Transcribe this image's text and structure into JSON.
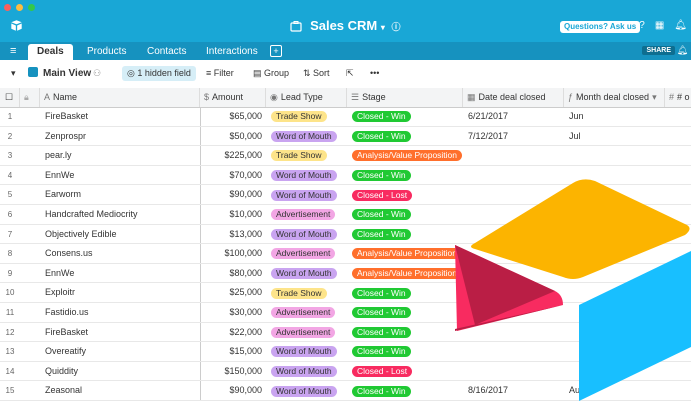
{
  "app": {
    "base_name": "Sales CRM",
    "questions_label": "Questions? Ask us",
    "share_label": "SHARE"
  },
  "tabs": [
    {
      "label": "Deals",
      "active": true
    },
    {
      "label": "Products"
    },
    {
      "label": "Contacts"
    },
    {
      "label": "Interactions"
    }
  ],
  "view": {
    "name": "Main View",
    "hidden_field_label": "1 hidden field",
    "filter_label": "Filter",
    "group_label": "Group",
    "sort_label": "Sort",
    "more_label": "•••"
  },
  "columns": {
    "name": "Name",
    "amount": "Amount",
    "lead_type": "Lead Type",
    "stage": "Stage",
    "date_closed": "Date deal closed",
    "month_closed": "Month deal closed",
    "extra": "# o"
  },
  "colors": {
    "topbar": "#19a7d6",
    "tabbar": "#1692bf",
    "trade_show": "#fde48a",
    "word_of_mouth": "#c9a4f0",
    "advertisement": "#f2a6e4",
    "closed_win": "#20c933",
    "closed_lost": "#f82b60",
    "analysis": "#ff6f2c"
  },
  "rows": [
    {
      "num": "1",
      "name": "FireBasket",
      "amount": "$65,000",
      "lead": "Trade Show",
      "stage": "Closed - Win",
      "date": "6/21/2017",
      "month": "Jun"
    },
    {
      "num": "2",
      "name": "Zenprospr",
      "amount": "$50,000",
      "lead": "Word of Mouth",
      "stage": "Closed - Win",
      "date": "7/12/2017",
      "month": "Jul"
    },
    {
      "num": "3",
      "name": "pear.ly",
      "amount": "$225,000",
      "lead": "Trade Show",
      "stage": "Analysis/Value Proposition",
      "date": "",
      "month": ""
    },
    {
      "num": "4",
      "name": "EnnWe",
      "amount": "$70,000",
      "lead": "Word of Mouth",
      "stage": "Closed - Win",
      "date": "",
      "month": ""
    },
    {
      "num": "5",
      "name": "Earworm",
      "amount": "$90,000",
      "lead": "Word of Mouth",
      "stage": "Closed - Lost",
      "date": "",
      "month": ""
    },
    {
      "num": "6",
      "name": "Handcrafted Mediocrity",
      "amount": "$10,000",
      "lead": "Advertisement",
      "stage": "Closed - Win",
      "date": "",
      "month": ""
    },
    {
      "num": "7",
      "name": "Objectively Edible",
      "amount": "$13,000",
      "lead": "Word of Mouth",
      "stage": "Closed - Win",
      "date": "",
      "month": ""
    },
    {
      "num": "8",
      "name": "Consens.us",
      "amount": "$100,000",
      "lead": "Advertisement",
      "stage": "Analysis/Value Proposition",
      "date": "",
      "month": ""
    },
    {
      "num": "9",
      "name": "EnnWe",
      "amount": "$80,000",
      "lead": "Word of Mouth",
      "stage": "Analysis/Value Proposition",
      "date": "",
      "month": ""
    },
    {
      "num": "10",
      "name": "Exploitr",
      "amount": "$25,000",
      "lead": "Trade Show",
      "stage": "Closed - Win",
      "date": "",
      "month": ""
    },
    {
      "num": "11",
      "name": "Fastidio.us",
      "amount": "$30,000",
      "lead": "Advertisement",
      "stage": "Closed - Win",
      "date": "",
      "month": ""
    },
    {
      "num": "12",
      "name": "FireBasket",
      "amount": "$22,000",
      "lead": "Advertisement",
      "stage": "Closed - Win",
      "date": "",
      "month": ""
    },
    {
      "num": "13",
      "name": "Overeatify",
      "amount": "$15,000",
      "lead": "Word of Mouth",
      "stage": "Closed - Win",
      "date": "",
      "month": ""
    },
    {
      "num": "14",
      "name": "Quiddity",
      "amount": "$150,000",
      "lead": "Word of Mouth",
      "stage": "Closed - Lost",
      "date": "",
      "month": ""
    },
    {
      "num": "15",
      "name": "Zeasonal",
      "amount": "$90,000",
      "lead": "Word of Mouth",
      "stage": "Closed - Win",
      "date": "8/16/2017",
      "month": "Aug"
    }
  ]
}
